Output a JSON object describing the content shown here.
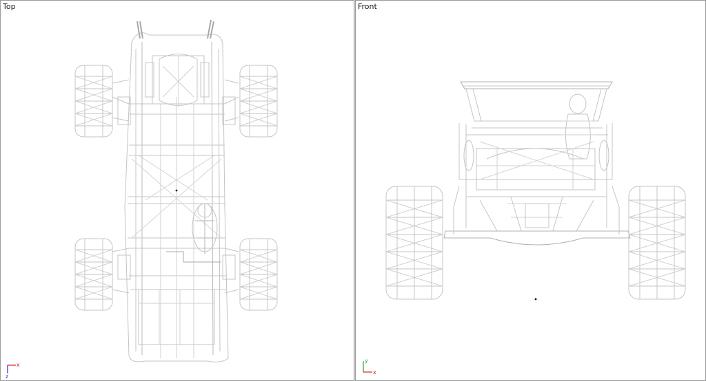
{
  "viewports": [
    {
      "label": "Top",
      "axis": {
        "horizontal": "x",
        "vertical": "z"
      }
    },
    {
      "label": "Front",
      "axis": {
        "horizontal": "x",
        "vertical": "y"
      }
    }
  ],
  "colors": {
    "wireframe": "#c4c4c4",
    "wireframe_dark": "#a8a8a8",
    "axis_x": "#d0202a",
    "axis_y": "#1fa51f",
    "axis_z": "#2030c8",
    "pivot": "#000000"
  }
}
